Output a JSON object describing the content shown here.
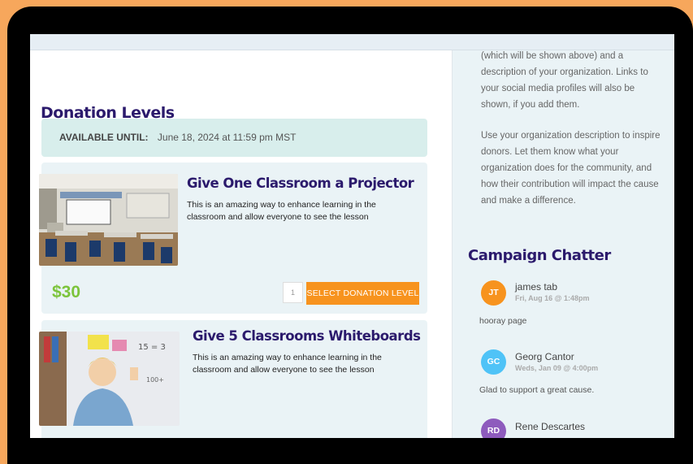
{
  "main": {
    "heading": "Donation Levels",
    "available_label": "AVAILABLE UNTIL:",
    "available_value": "June 18, 2024 at 11:59 pm MST",
    "levels": [
      {
        "title": "Give One Classroom a Projector",
        "description": "This is an amazing way to enhance learning in the classroom and allow everyone to see the lesson",
        "price": "$30",
        "quantity": "1",
        "button": "SELECT DONATION LEVEL"
      },
      {
        "title": "Give 5 Classrooms Whiteboards",
        "description": "This is an amazing way to enhance learning in the classroom and allow everyone to see the lesson"
      }
    ]
  },
  "sidebar": {
    "intro_1": "(which will be shown above) and a description of your organization. Links to your social media profiles will also be shown, if you add them.",
    "intro_2": "Use your organization description to inspire donors. Let them know what your organization does for the community, and how their contribution will impact the cause and make a difference.",
    "chatter_heading": "Campaign Chatter",
    "comments": [
      {
        "initials": "JT",
        "name": "james tab",
        "date": "Fri, Aug 16 @ 1:48pm",
        "message": "hooray page",
        "color": "#f7931e"
      },
      {
        "initials": "GC",
        "name": "Georg Cantor",
        "date": "Weds, Jan 09 @ 4:00pm",
        "message": "Glad to support a great cause.",
        "color": "#4fc3f7"
      },
      {
        "initials": "RD",
        "name": "Rene Descartes",
        "date": "",
        "message": "",
        "color": "#8e5bbd"
      }
    ]
  },
  "colors": {
    "accent": "#f7931e",
    "heading": "#2b1a6c",
    "price": "#7cc43b"
  }
}
